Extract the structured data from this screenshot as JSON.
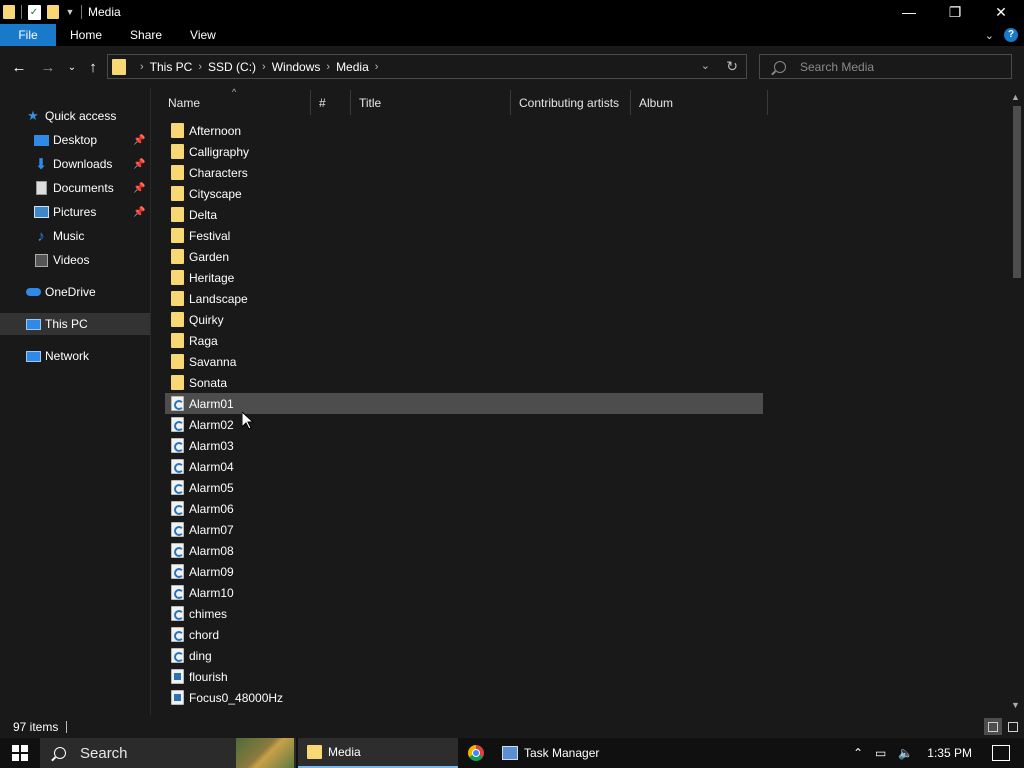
{
  "window": {
    "title": "Media",
    "controls": {
      "minimize": "—",
      "maximize": "❐",
      "close": "✕"
    }
  },
  "ribbon": {
    "tabs": [
      "File",
      "Home",
      "Share",
      "View"
    ]
  },
  "address": {
    "crumbs": [
      "This PC",
      "SSD (C:)",
      "Windows",
      "Media"
    ]
  },
  "search": {
    "placeholder": "Search Media"
  },
  "nav": {
    "quick_access": "Quick access",
    "items": [
      {
        "label": "Desktop",
        "icon": "desktop-icon",
        "pinned": true
      },
      {
        "label": "Downloads",
        "icon": "downloads-icon",
        "pinned": true
      },
      {
        "label": "Documents",
        "icon": "documents-icon",
        "pinned": true
      },
      {
        "label": "Pictures",
        "icon": "pictures-icon",
        "pinned": true
      },
      {
        "label": "Music",
        "icon": "music-icon",
        "pinned": false
      },
      {
        "label": "Videos",
        "icon": "videos-icon",
        "pinned": false
      }
    ],
    "onedrive": "OneDrive",
    "this_pc": "This PC",
    "network": "Network"
  },
  "columns": [
    "Name",
    "#",
    "Title",
    "Contributing artists",
    "Album"
  ],
  "files": [
    {
      "name": "Afternoon",
      "type": "folder"
    },
    {
      "name": "Calligraphy",
      "type": "folder"
    },
    {
      "name": "Characters",
      "type": "folder"
    },
    {
      "name": "Cityscape",
      "type": "folder"
    },
    {
      "name": "Delta",
      "type": "folder"
    },
    {
      "name": "Festival",
      "type": "folder"
    },
    {
      "name": "Garden",
      "type": "folder"
    },
    {
      "name": "Heritage",
      "type": "folder"
    },
    {
      "name": "Landscape",
      "type": "folder"
    },
    {
      "name": "Quirky",
      "type": "folder"
    },
    {
      "name": "Raga",
      "type": "folder"
    },
    {
      "name": "Savanna",
      "type": "folder"
    },
    {
      "name": "Sonata",
      "type": "folder"
    },
    {
      "name": "Alarm01",
      "type": "audio",
      "hover": true
    },
    {
      "name": "Alarm02",
      "type": "audio"
    },
    {
      "name": "Alarm03",
      "type": "audio"
    },
    {
      "name": "Alarm04",
      "type": "audio"
    },
    {
      "name": "Alarm05",
      "type": "audio"
    },
    {
      "name": "Alarm06",
      "type": "audio"
    },
    {
      "name": "Alarm07",
      "type": "audio"
    },
    {
      "name": "Alarm08",
      "type": "audio"
    },
    {
      "name": "Alarm09",
      "type": "audio"
    },
    {
      "name": "Alarm10",
      "type": "audio"
    },
    {
      "name": "chimes",
      "type": "audio"
    },
    {
      "name": "chord",
      "type": "audio"
    },
    {
      "name": "ding",
      "type": "audio"
    },
    {
      "name": "flourish",
      "type": "media"
    },
    {
      "name": "Focus0_48000Hz",
      "type": "media"
    }
  ],
  "status": {
    "item_count": "97 items"
  },
  "taskbar": {
    "search_label": "Search",
    "apps": [
      "Media",
      "Task Manager"
    ],
    "time": "1:35 PM"
  },
  "colors": {
    "accent": "#1979ca",
    "folder": "#f8d775",
    "hover_row": "#4d4d4d",
    "selected_nav": "#333333"
  }
}
